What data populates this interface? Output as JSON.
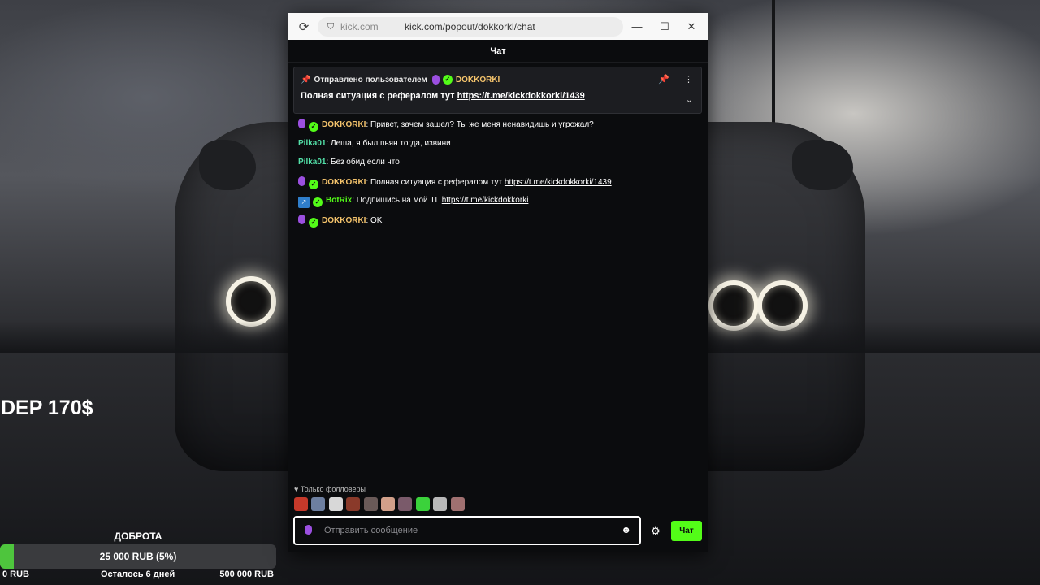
{
  "overlay": {
    "dep_label": "DEP 170$",
    "goal": {
      "title": "ДОБРОТА",
      "amount": "25 000 RUB (5%)",
      "progress_percent": 5,
      "start": "0 RUB",
      "remaining": "Осталось 6 дней",
      "target": "500 000 RUB"
    }
  },
  "browser": {
    "host": "kick.com",
    "url": "kick.com/popout/dokkorkl/chat",
    "minimize": "—",
    "maximize": "☐",
    "close": "✕"
  },
  "chat": {
    "title": "Чат",
    "pinned": {
      "by_label": "Отправлено пользователем",
      "user": "DOKKORKI",
      "text": "Полная ситуация с рефералом тут ",
      "link": "https://t.me/kickdokkorki/1439"
    },
    "messages": [
      {
        "user": "DOKKORKI",
        "kind": "dok",
        "badges": [
          "mic",
          "verified"
        ],
        "text": ": Привет, зачем зашел? Ты же меня ненавидишь и угрожал?",
        "link": ""
      },
      {
        "user": "Pilka01",
        "kind": "pilka",
        "badges": [],
        "text": ": Леша, я был пьян тогда, извини",
        "link": ""
      },
      {
        "user": "Pilka01",
        "kind": "pilka",
        "badges": [],
        "text": ": Без обид если что",
        "link": ""
      },
      {
        "user": "DOKKORKI",
        "kind": "dok",
        "badges": [
          "mic",
          "verified"
        ],
        "text": ": Полная ситуация с рефералом тут ",
        "link": "https://t.me/kickdokkorki/1439"
      },
      {
        "user": "BotRix",
        "kind": "bot",
        "badges": [
          "bot",
          "verified"
        ],
        "text": ": Подпишись на мой ТГ ",
        "link": "https://t.me/kickdokkorki"
      },
      {
        "user": "DOKKORKI",
        "kind": "dok",
        "badges": [
          "mic",
          "verified"
        ],
        "text": ": OK",
        "link": ""
      }
    ],
    "followers_only": "Только фолловеры",
    "emote_colors": [
      "#c6392a",
      "#6d7fa0",
      "#d8d8d8",
      "#8a3a2a",
      "#6a5a58",
      "#d2a08a",
      "#7a5a6a",
      "#3bd23b",
      "#b8b8b8",
      "#a07070"
    ],
    "input_placeholder": "Отправить сообщение",
    "send_label": "Чат"
  },
  "colors": {
    "accent": "#53fc18",
    "username_dokkorki": "#f5c46c",
    "username_pilka": "#53e0a8"
  }
}
